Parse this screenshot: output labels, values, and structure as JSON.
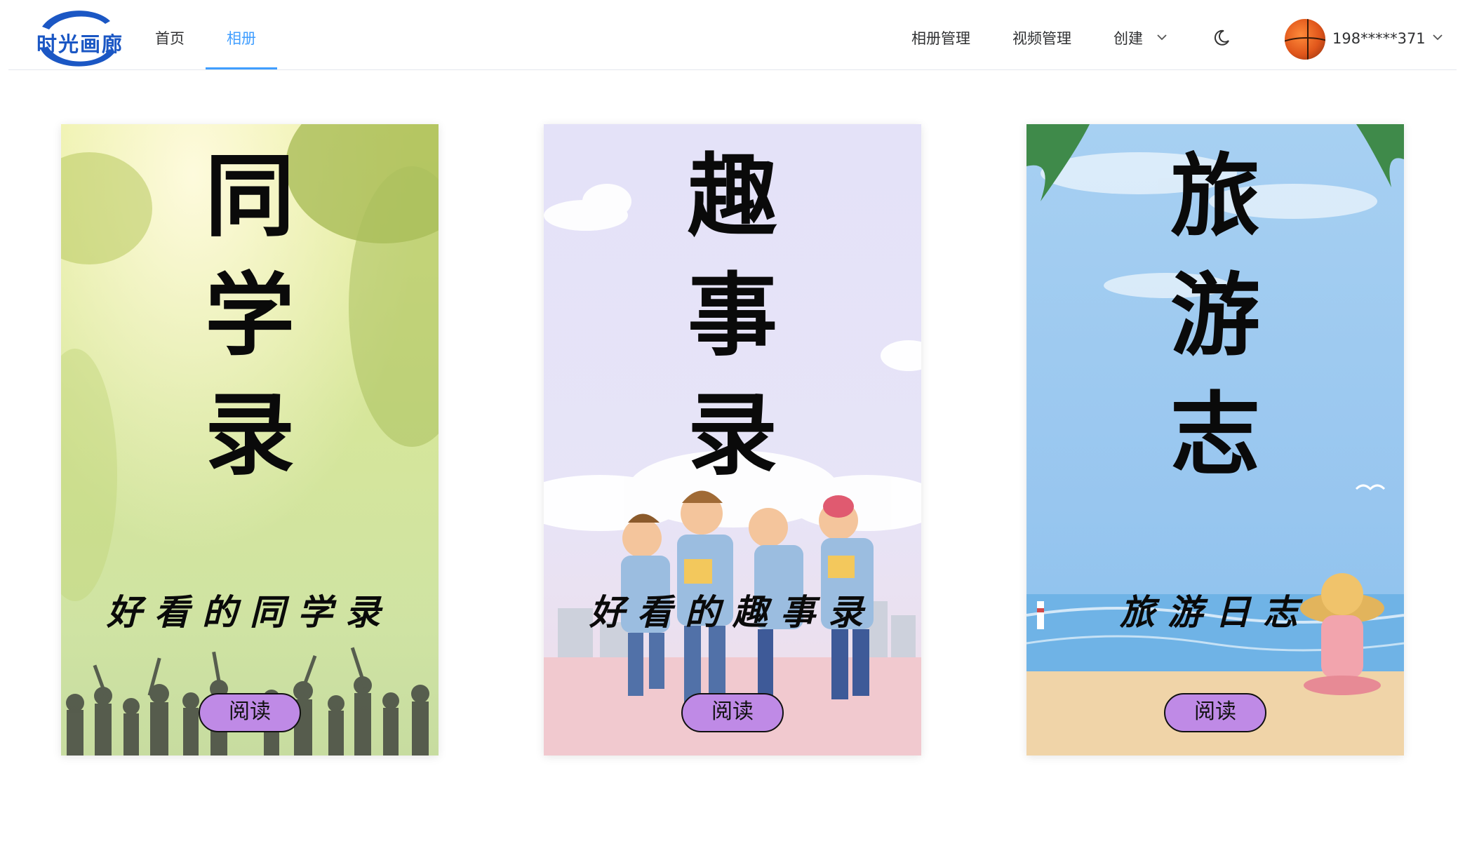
{
  "header": {
    "logo_text": "时光画廊",
    "nav": [
      {
        "label": "首页",
        "active": false
      },
      {
        "label": "相册",
        "active": true
      }
    ],
    "menus": {
      "album_manage": "相册管理",
      "video_manage": "视频管理",
      "create": "创建"
    },
    "theme_icon": "moon-icon",
    "user": {
      "name": "198*****371",
      "avatar_icon": "basketball-avatar"
    }
  },
  "cards": [
    {
      "title_chars": [
        "同",
        "学",
        "录"
      ],
      "subtitle": "好看的同学录",
      "button": "阅读",
      "theme": "green-forest"
    },
    {
      "title_chars": [
        "趣",
        "事",
        "录"
      ],
      "subtitle": "好看的趣事录",
      "button": "阅读",
      "theme": "lavender-cartoon"
    },
    {
      "title_chars": [
        "旅",
        "游",
        "志"
      ],
      "subtitle": "旅游日志",
      "button": "阅读",
      "theme": "blue-beach"
    }
  ],
  "colors": {
    "accent": "#409eff",
    "button_fill": "#bf8ae6",
    "logo_blue": "#1b57c4"
  }
}
